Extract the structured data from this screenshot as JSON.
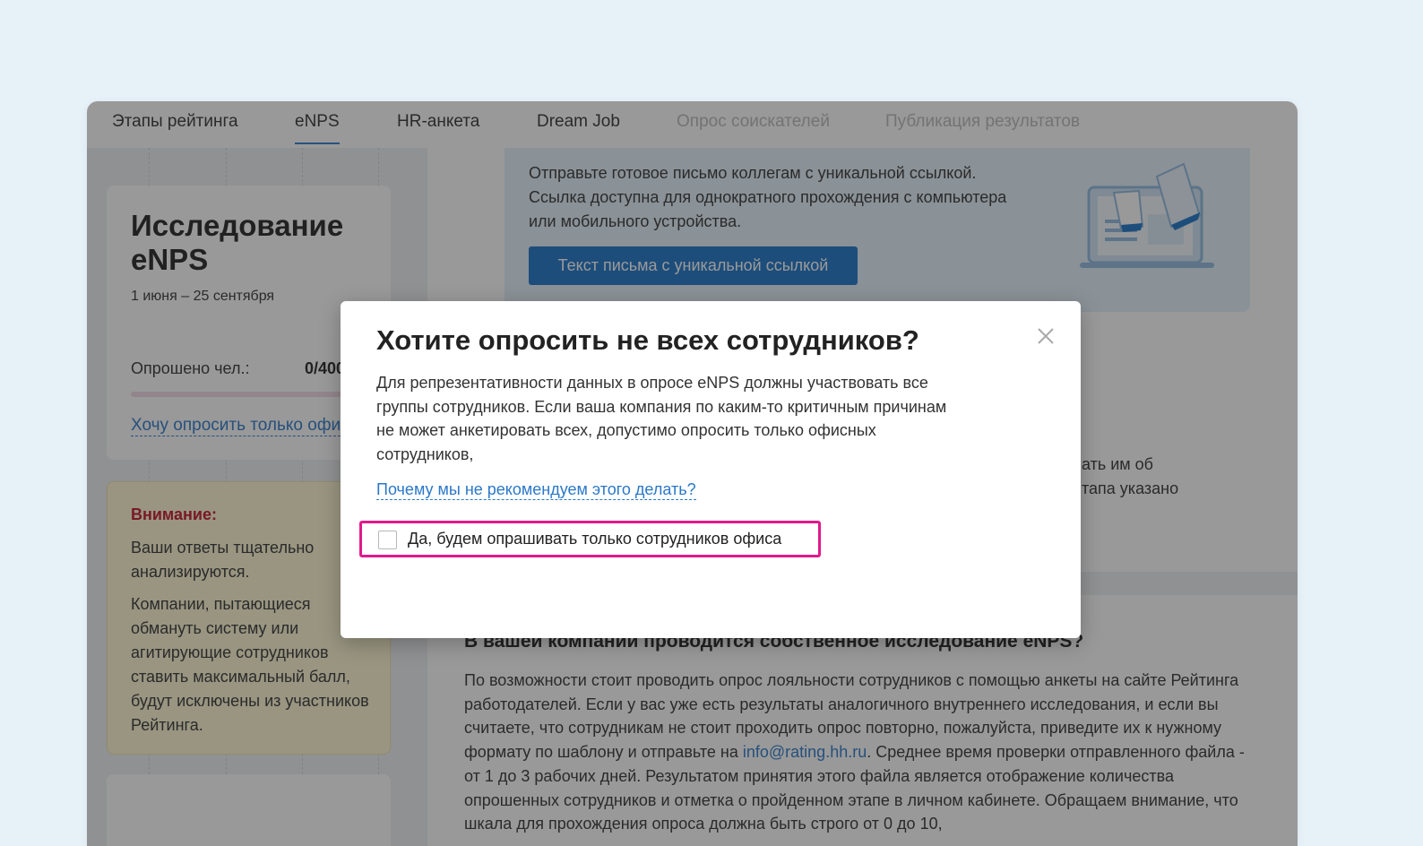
{
  "nav": {
    "items": [
      {
        "label": "Этапы рейтинга",
        "state": "normal"
      },
      {
        "label": "eNPS",
        "state": "active"
      },
      {
        "label": "HR-анкета",
        "state": "normal"
      },
      {
        "label": "Dream Job",
        "state": "normal"
      },
      {
        "label": "Опрос соискателей",
        "state": "disabled"
      },
      {
        "label": "Публикация результатов",
        "state": "disabled"
      }
    ]
  },
  "study_card": {
    "title": "Исследование eNPS",
    "date": "1 июня – 25 сентября",
    "count_label": "Опрошено чел.:",
    "count_value": "0/400",
    "progress": 0,
    "office_link": "Хочу опросить только офис"
  },
  "warning": {
    "title": "Внимание:",
    "p1": "Ваши ответы тщательно анализируются.",
    "p2": "Компании, пытающиеся обмануть систему или агитирующие сотрудников ставить максимальный балл, будут исключены из участников Рейтинга."
  },
  "banner": {
    "text": "Отправьте готовое письмо коллегам с уникальной ссылкой. Ссылка доступна для однократного прохождения с компьютера или мобильного устройства.",
    "button": "Текст письма с уникальной ссылкой"
  },
  "background_text": {
    "line1": "ать им об",
    "line2": "тапа указано"
  },
  "article": {
    "heading": "В вашей компании проводится собственное исследование eNPS?",
    "p_before": "По возможности стоит проводить опрос лояльности сотрудников с помощью анкеты на сайте Рейтинга работодателей. Если у вас уже есть результаты аналогичного внутреннего исследования, и если вы считаете, что сотрудникам не стоит проходить опрос повторно, пожалуйста, приведите их к нужному формату по шаблону и отправьте на ",
    "email": "info@rating.hh.ru",
    "p_after": ". Среднее время проверки отправленного файла - от 1 до 3 рабочих дней. Результатом принятия этого файла является отображение количества опрошенных сотрудников и отметка о пройденном этапе в личном кабинете. Обращаем внимание, что шкала для прохождения опроса должна быть строго от 0 до 10,"
  },
  "modal": {
    "title": "Хотите опросить не всех сотрудников?",
    "body": "Для репрезентативности данных в опросе eNPS должны участвовать все группы сотрудников. Если ваша компания по каким-то критичным причинам не может анкетировать всех, допустимо опросить только офисных сотрудников,",
    "link": "Почему мы не рекомендуем этого делать?",
    "checkbox_label": "Да, будем опрашивать только сотрудников офиса",
    "checkbox_checked": false
  },
  "colors": {
    "accent": "#1a74c7",
    "link": "#2b78c9",
    "warning_title": "#c4122f",
    "highlight": "#e2198c",
    "page_bg": "#e6f1f8"
  }
}
